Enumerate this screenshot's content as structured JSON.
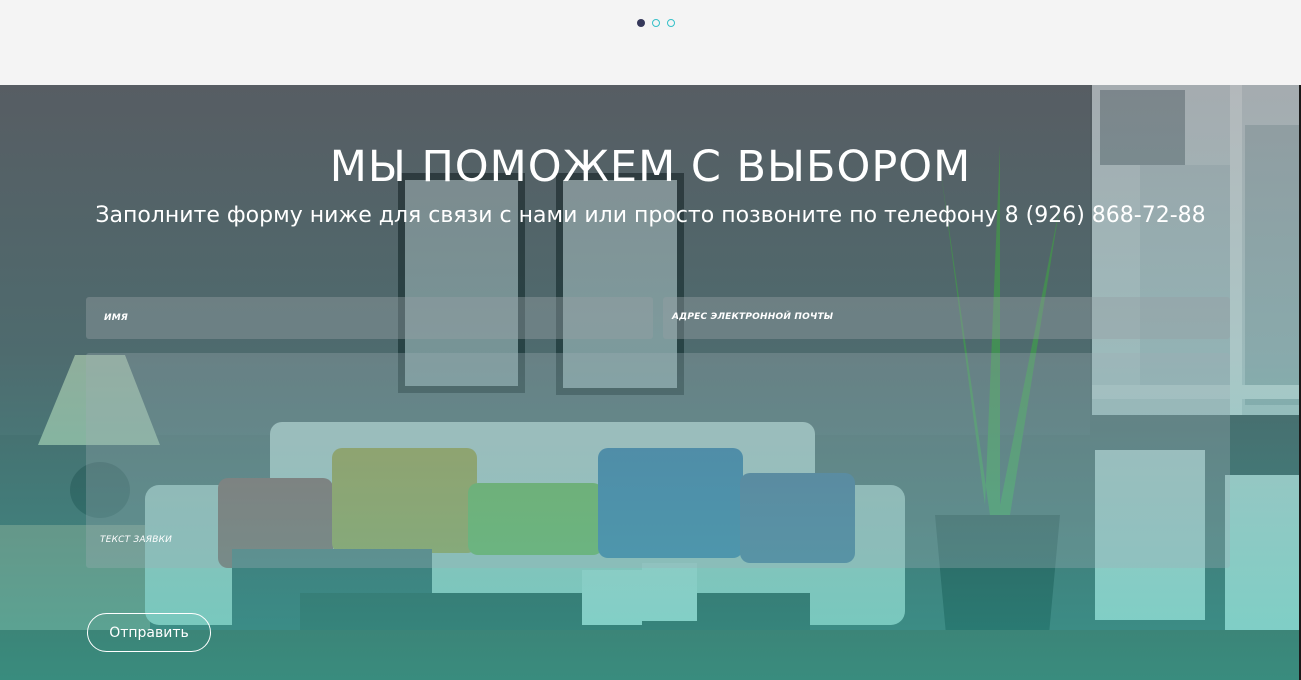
{
  "carousel": {
    "dots": [
      {
        "state": "active"
      },
      {
        "state": "inactive"
      },
      {
        "state": "inactive"
      }
    ]
  },
  "contact": {
    "title": "МЫ ПОМОЖЕМ С ВЫБОРОМ",
    "subtitle": "Заполните форму ниже для связи с нами или просто позвоните по телефону 8 (926) 868-72-88",
    "name_placeholder": "ИМЯ",
    "email_placeholder": "АДРЕС ЭЛЕКТРОННОЙ ПОЧТЫ",
    "message_placeholder": "ТЕКСТ ЗАЯВКИ",
    "submit_label": "Отправить"
  },
  "colors": {
    "dot_active": "#35385a",
    "dot_inactive": "#35c0c8",
    "accent_teal": "#2bb2a6"
  }
}
